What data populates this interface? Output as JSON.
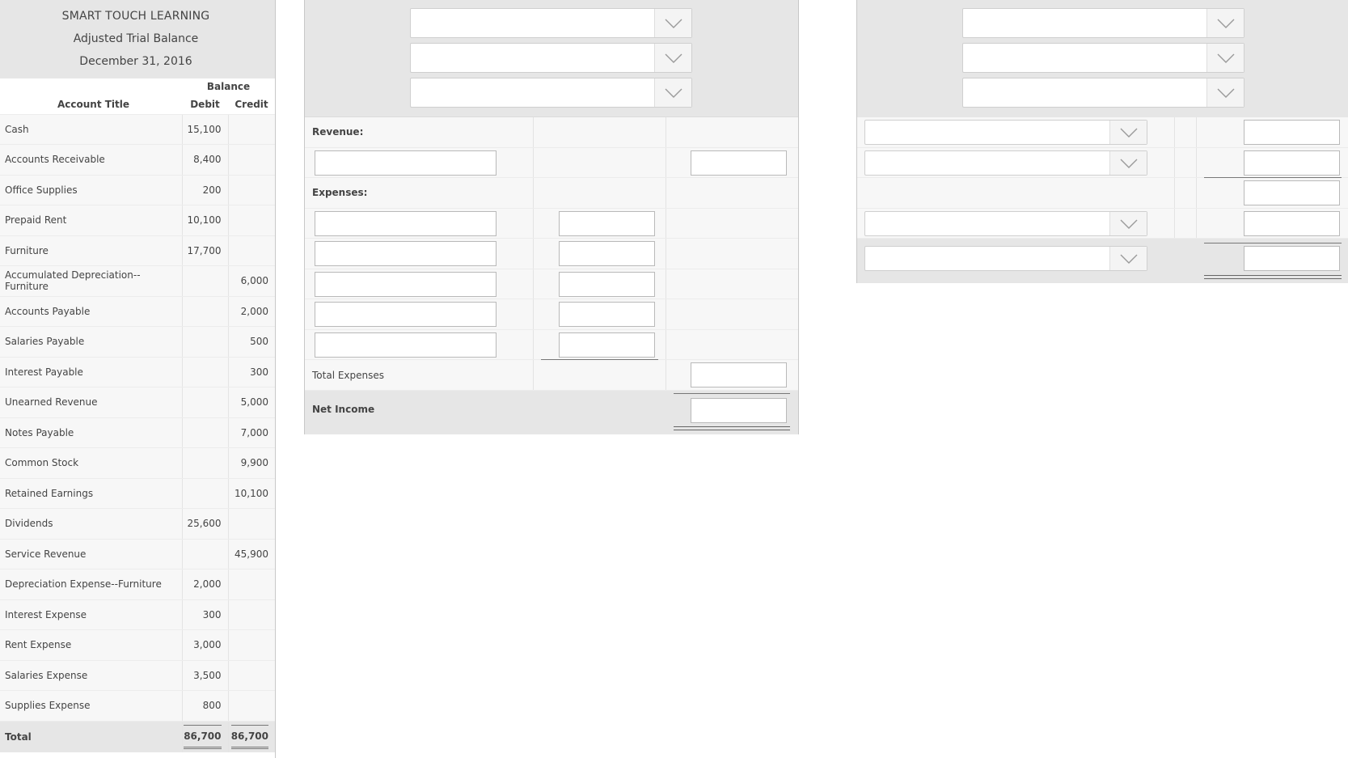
{
  "trial_balance": {
    "company": "SMART TOUCH LEARNING",
    "title": "Adjusted Trial Balance",
    "date": "December 31, 2016",
    "balance_header": "Balance",
    "col_account": "Account Title",
    "col_debit": "Debit",
    "col_credit": "Credit",
    "rows": [
      {
        "account": "Cash",
        "debit": "15,100",
        "credit": ""
      },
      {
        "account": "Accounts Receivable",
        "debit": "8,400",
        "credit": ""
      },
      {
        "account": "Office Supplies",
        "debit": "200",
        "credit": ""
      },
      {
        "account": "Prepaid Rent",
        "debit": "10,100",
        "credit": ""
      },
      {
        "account": "Furniture",
        "debit": "17,700",
        "credit": ""
      },
      {
        "account": "Accumulated Depreciation--Furniture",
        "debit": "",
        "credit": "6,000"
      },
      {
        "account": "Accounts Payable",
        "debit": "",
        "credit": "2,000"
      },
      {
        "account": "Salaries Payable",
        "debit": "",
        "credit": "500"
      },
      {
        "account": "Interest Payable",
        "debit": "",
        "credit": "300"
      },
      {
        "account": "Unearned Revenue",
        "debit": "",
        "credit": "5,000"
      },
      {
        "account": "Notes Payable",
        "debit": "",
        "credit": "7,000"
      },
      {
        "account": "Common Stock",
        "debit": "",
        "credit": "9,900"
      },
      {
        "account": "Retained Earnings",
        "debit": "",
        "credit": "10,100"
      },
      {
        "account": "Dividends",
        "debit": "25,600",
        "credit": ""
      },
      {
        "account": "Service Revenue",
        "debit": "",
        "credit": "45,900"
      },
      {
        "account": "Depreciation Expense--Furniture",
        "debit": "2,000",
        "credit": ""
      },
      {
        "account": "Interest Expense",
        "debit": "300",
        "credit": ""
      },
      {
        "account": "Rent Expense",
        "debit": "3,000",
        "credit": ""
      },
      {
        "account": "Salaries Expense",
        "debit": "3,500",
        "credit": ""
      },
      {
        "account": "Supplies Expense",
        "debit": "800",
        "credit": ""
      }
    ],
    "total": {
      "label": "Total",
      "debit": "86,700",
      "credit": "86,700"
    }
  },
  "income_statement": {
    "revenue_label": "Revenue:",
    "expenses_label": "Expenses:",
    "total_expenses_label": "Total Expenses",
    "net_income_label": "Net Income"
  },
  "icons": {
    "dropdown": "chevron-down-icon"
  }
}
